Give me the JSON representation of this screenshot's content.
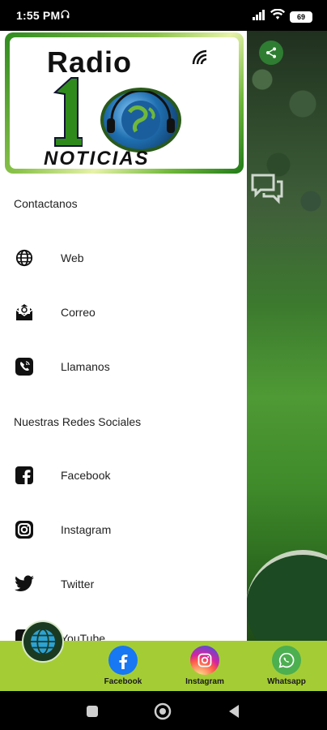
{
  "status_bar": {
    "time": "1:55 PM",
    "battery": "69"
  },
  "logo": {
    "line1": "Radio",
    "number": "10",
    "line2": "NOTICIAS"
  },
  "drawer": {
    "contact_title": "Contactanos",
    "contact_items": [
      {
        "label": "Web",
        "icon": "globe-icon"
      },
      {
        "label": "Correo",
        "icon": "mail-icon"
      },
      {
        "label": "Llamanos",
        "icon": "phone-icon"
      }
    ],
    "social_title": "Nuestras Redes Sociales",
    "social_items": [
      {
        "label": "Facebook",
        "icon": "facebook-icon"
      },
      {
        "label": "Instagram",
        "icon": "instagram-icon"
      },
      {
        "label": "Twitter",
        "icon": "twitter-icon"
      },
      {
        "label": "YouTube",
        "icon": "youtube-icon"
      }
    ]
  },
  "bottom_bar": {
    "items": [
      {
        "label": "Facebook",
        "color": "#1877f2"
      },
      {
        "label": "Instagram",
        "color": "#e1306c"
      },
      {
        "label": "Whatsapp",
        "color": "#4caf50"
      }
    ]
  },
  "colors": {
    "accent_green": "#a4cd35",
    "drawer_bg": "#ffffff"
  }
}
